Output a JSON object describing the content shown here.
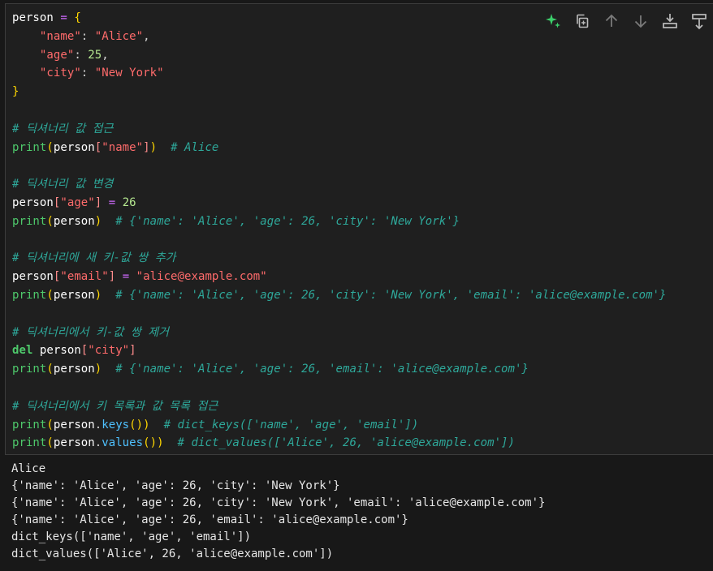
{
  "toolbar": {
    "buttons": [
      {
        "name": "sparkle-ai-icon",
        "color": "#3ccf6b"
      },
      {
        "name": "copy-cell-icon",
        "color": "#bbbbbb"
      },
      {
        "name": "move-up-arrow-icon",
        "color": "#7a7a7a"
      },
      {
        "name": "move-down-arrow-icon",
        "color": "#7a7a7a"
      },
      {
        "name": "insert-cell-below-icon",
        "color": "#bbbbbb"
      },
      {
        "name": "split-cell-icon",
        "color": "#bbbbbb"
      }
    ]
  },
  "code": {
    "lines": [
      [
        {
          "t": "person",
          "c": "var"
        },
        {
          "t": " ",
          "c": "pl"
        },
        {
          "t": "=",
          "c": "op"
        },
        {
          "t": " ",
          "c": "pl"
        },
        {
          "t": "{",
          "c": "br"
        }
      ],
      [
        {
          "t": "    ",
          "c": "pl"
        },
        {
          "t": "\"name\"",
          "c": "str"
        },
        {
          "t": ": ",
          "c": "pl"
        },
        {
          "t": "\"Alice\"",
          "c": "str"
        },
        {
          "t": ",",
          "c": "pl"
        }
      ],
      [
        {
          "t": "    ",
          "c": "pl"
        },
        {
          "t": "\"age\"",
          "c": "str"
        },
        {
          "t": ": ",
          "c": "pl"
        },
        {
          "t": "25",
          "c": "num"
        },
        {
          "t": ",",
          "c": "pl"
        }
      ],
      [
        {
          "t": "    ",
          "c": "pl"
        },
        {
          "t": "\"city\"",
          "c": "str"
        },
        {
          "t": ": ",
          "c": "pl"
        },
        {
          "t": "\"New York\"",
          "c": "str"
        }
      ],
      [
        {
          "t": "}",
          "c": "br"
        }
      ],
      [],
      [
        {
          "t": "# 딕셔너리 값 접근",
          "c": "cm"
        }
      ],
      [
        {
          "t": "print",
          "c": "fn"
        },
        {
          "t": "(",
          "c": "br"
        },
        {
          "t": "person",
          "c": "var"
        },
        {
          "t": "[",
          "c": "sbr"
        },
        {
          "t": "\"name\"",
          "c": "str"
        },
        {
          "t": "]",
          "c": "sbr"
        },
        {
          "t": ")",
          "c": "br"
        },
        {
          "t": "  ",
          "c": "pl"
        },
        {
          "t": "# Alice",
          "c": "cm"
        }
      ],
      [],
      [
        {
          "t": "# 딕셔너리 값 변경",
          "c": "cm"
        }
      ],
      [
        {
          "t": "person",
          "c": "var"
        },
        {
          "t": "[",
          "c": "sbr"
        },
        {
          "t": "\"age\"",
          "c": "str"
        },
        {
          "t": "]",
          "c": "sbr"
        },
        {
          "t": " ",
          "c": "pl"
        },
        {
          "t": "=",
          "c": "op"
        },
        {
          "t": " ",
          "c": "pl"
        },
        {
          "t": "26",
          "c": "num"
        }
      ],
      [
        {
          "t": "print",
          "c": "fn"
        },
        {
          "t": "(",
          "c": "br"
        },
        {
          "t": "person",
          "c": "var"
        },
        {
          "t": ")",
          "c": "br"
        },
        {
          "t": "  ",
          "c": "pl"
        },
        {
          "t": "# {'name': 'Alice', 'age': 26, 'city': 'New York'}",
          "c": "cm"
        }
      ],
      [],
      [
        {
          "t": "# 딕셔너리에 새 키-값 쌍 추가",
          "c": "cm"
        }
      ],
      [
        {
          "t": "person",
          "c": "var"
        },
        {
          "t": "[",
          "c": "sbr"
        },
        {
          "t": "\"email\"",
          "c": "str"
        },
        {
          "t": "]",
          "c": "sbr"
        },
        {
          "t": " ",
          "c": "pl"
        },
        {
          "t": "=",
          "c": "op"
        },
        {
          "t": " ",
          "c": "pl"
        },
        {
          "t": "\"alice@example.com\"",
          "c": "str"
        }
      ],
      [
        {
          "t": "print",
          "c": "fn"
        },
        {
          "t": "(",
          "c": "br"
        },
        {
          "t": "person",
          "c": "var"
        },
        {
          "t": ")",
          "c": "br"
        },
        {
          "t": "  ",
          "c": "pl"
        },
        {
          "t": "# {'name': 'Alice', 'age': 26, 'city': 'New York', 'email': 'alice@example.com'}",
          "c": "cm"
        }
      ],
      [],
      [
        {
          "t": "# 딕셔너리에서 키-값 쌍 제거",
          "c": "cm"
        }
      ],
      [
        {
          "t": "del",
          "c": "kw"
        },
        {
          "t": " ",
          "c": "pl"
        },
        {
          "t": "person",
          "c": "var"
        },
        {
          "t": "[",
          "c": "sbr"
        },
        {
          "t": "\"city\"",
          "c": "str"
        },
        {
          "t": "]",
          "c": "sbr"
        }
      ],
      [
        {
          "t": "print",
          "c": "fn"
        },
        {
          "t": "(",
          "c": "br"
        },
        {
          "t": "person",
          "c": "var"
        },
        {
          "t": ")",
          "c": "br"
        },
        {
          "t": "  ",
          "c": "pl"
        },
        {
          "t": "# {'name': 'Alice', 'age': 26, 'email': 'alice@example.com'}",
          "c": "cm"
        }
      ],
      [],
      [
        {
          "t": "# 딕셔너리에서 키 목록과 값 목록 접근",
          "c": "cm"
        }
      ],
      [
        {
          "t": "print",
          "c": "fn"
        },
        {
          "t": "(",
          "c": "br"
        },
        {
          "t": "person",
          "c": "var"
        },
        {
          "t": ".",
          "c": "pl"
        },
        {
          "t": "keys",
          "c": "meth"
        },
        {
          "t": "()",
          "c": "br"
        },
        {
          "t": ")",
          "c": "br"
        },
        {
          "t": "  ",
          "c": "pl"
        },
        {
          "t": "# dict_keys(['name', 'age', 'email'])",
          "c": "cm"
        }
      ],
      [
        {
          "t": "print",
          "c": "fn"
        },
        {
          "t": "(",
          "c": "br"
        },
        {
          "t": "person",
          "c": "var"
        },
        {
          "t": ".",
          "c": "pl"
        },
        {
          "t": "values",
          "c": "meth"
        },
        {
          "t": "()",
          "c": "br"
        },
        {
          "t": ")",
          "c": "br"
        },
        {
          "t": "  ",
          "c": "pl"
        },
        {
          "t": "# dict_values(['Alice', 26, 'alice@example.com'])",
          "c": "cm"
        }
      ]
    ]
  },
  "output": {
    "lines": [
      "Alice",
      "{'name': 'Alice', 'age': 26, 'city': 'New York'}",
      "{'name': 'Alice', 'age': 26, 'city': 'New York', 'email': 'alice@example.com'}",
      "{'name': 'Alice', 'age': 26, 'email': 'alice@example.com'}",
      "dict_keys(['name', 'age', 'email'])",
      "dict_values(['Alice', 26, 'alice@example.com'])"
    ]
  }
}
